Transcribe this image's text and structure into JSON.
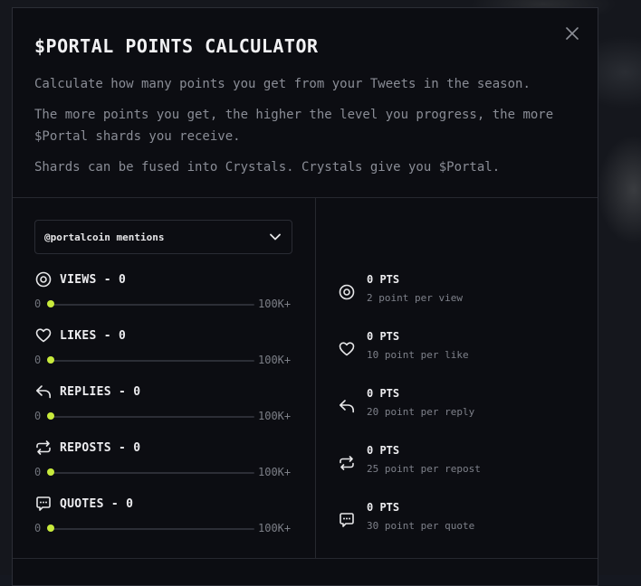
{
  "modal": {
    "title": "$PORTAL POINTS CALCULATOR",
    "description": [
      "Calculate how many points you get from your Tweets in the season.",
      "The more points you get, the higher the level you progress, the more $Portal shards you receive.",
      "Shards can be fused into Crystals. Crystals give you $Portal."
    ]
  },
  "filter": {
    "selected": "@portalcoin mentions"
  },
  "metrics": [
    {
      "label": "VIEWS - 0",
      "min": "0",
      "max": "100K+",
      "value": 0,
      "icon": "eye-icon"
    },
    {
      "label": "LIKES - 0",
      "min": "0",
      "max": "100K+",
      "value": 0,
      "icon": "heart-icon"
    },
    {
      "label": "REPLIES - 0",
      "min": "0",
      "max": "100K+",
      "value": 0,
      "icon": "reply-icon"
    },
    {
      "label": "REPOSTS - 0",
      "min": "0",
      "max": "100K+",
      "value": 0,
      "icon": "repost-icon"
    },
    {
      "label": "QUOTES - 0",
      "min": "0",
      "max": "100K+",
      "value": 0,
      "icon": "quote-icon"
    }
  ],
  "points": [
    {
      "value": "0 PTS",
      "rate": "2 point per view",
      "icon": "eye-icon"
    },
    {
      "value": "0 PTS",
      "rate": "10 point per like",
      "icon": "heart-icon"
    },
    {
      "value": "0 PTS",
      "rate": "20 point per reply",
      "icon": "reply-icon"
    },
    {
      "value": "0 PTS",
      "rate": "25 point per repost",
      "icon": "repost-icon"
    },
    {
      "value": "0 PTS",
      "rate": "30 point per quote",
      "icon": "quote-icon"
    }
  ],
  "colors": {
    "accent": "#c8ea3c",
    "background": "#0c0d12",
    "border": "#2c2e36"
  }
}
